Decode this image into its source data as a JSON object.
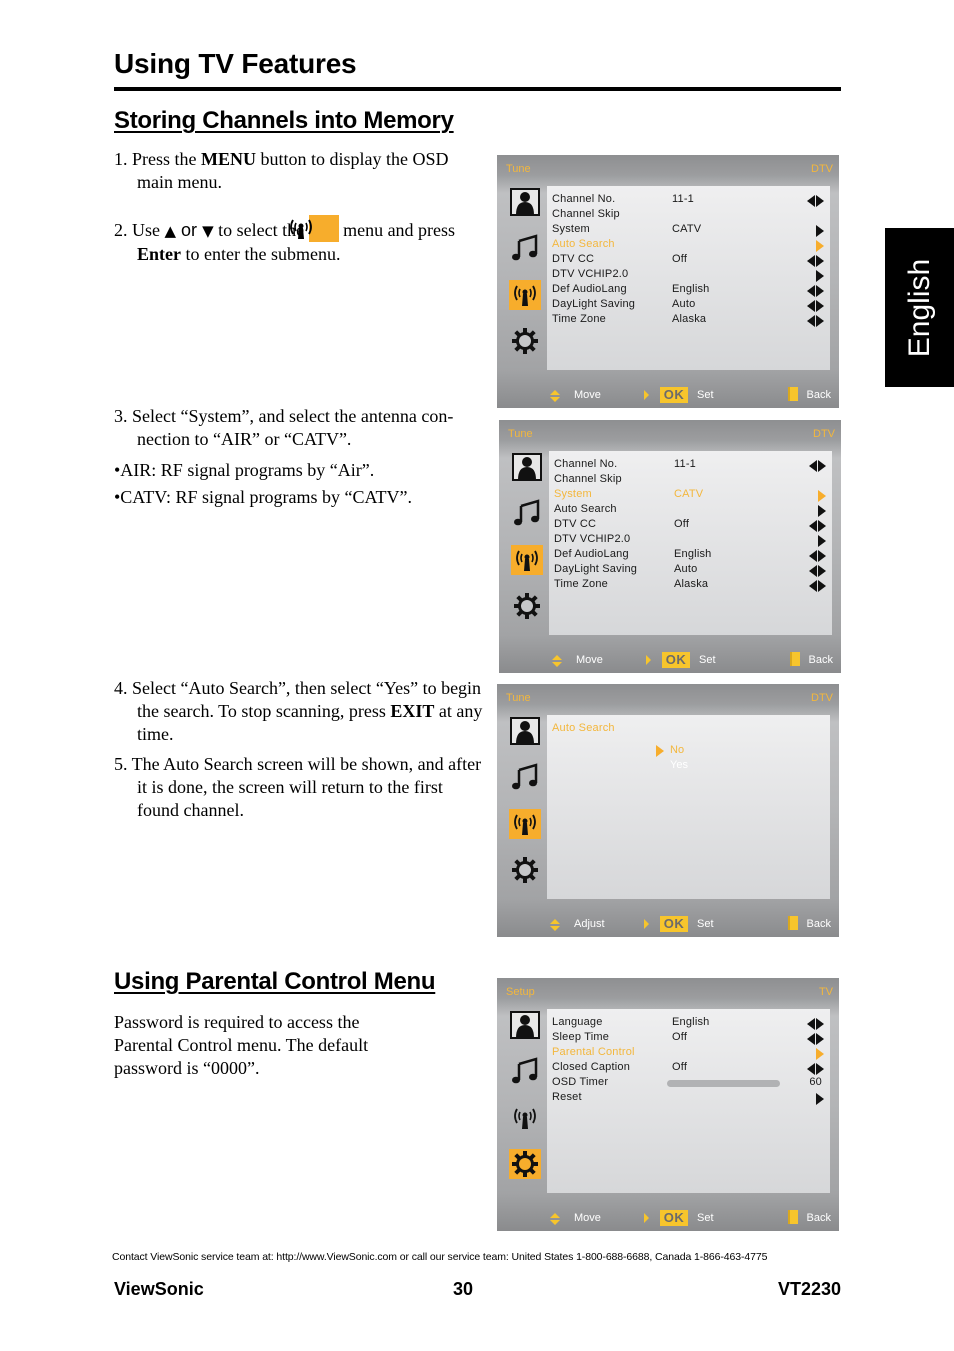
{
  "header": {
    "title": "Using TV Features",
    "language_tab": "English"
  },
  "section1": {
    "title": "Storing Channels into Memory",
    "step1": {
      "prefix": "1. Press the ",
      "bold": "MENU",
      "suffix": " button to display the OSD main menu."
    },
    "step2": {
      "prefix": "2. Use ",
      "up_arrow": "▲",
      "or": " or ",
      "down_arrow": "▼",
      "middle": " to select the ",
      "icon": "antenna-icon",
      "after_icon": " menu and press ",
      "bold": "Enter",
      "suffix": " to enter the submenu."
    },
    "step3": "3. Select “System”, and select the antenna con-nection to “AIR” or “CATV”.",
    "bullet_air": "•AIR: RF signal programs by “Air”.",
    "bullet_catv": "•CATV: RF signal programs by “CATV”.",
    "step4": {
      "prefix": "4. Select “Auto Search”, then select “Yes” to begin the search. To stop scanning, press ",
      "bold": "EXIT",
      "suffix": " at any time."
    },
    "step5": "5. The Auto Search screen will be shown, and after it is done, the screen will return to the first found channel."
  },
  "section2": {
    "title": "Using Parental Control Menu",
    "body": "Password is required to access the Parental Control menu. The default password is “0000”."
  },
  "osd_colors": {
    "accent": "#f7ad2c",
    "highlight_text": "#f3b73d",
    "panel": "#e4e5e6"
  },
  "osd1": {
    "title": "Tune",
    "mode": "DTV",
    "active_icon": "antenna",
    "rows": [
      {
        "label": "Channel No.",
        "value": "11-1",
        "control": "left-right"
      },
      {
        "label": "Channel Skip",
        "value": "",
        "control": "none"
      },
      {
        "label": "System",
        "value": "CATV",
        "control": "right"
      },
      {
        "label": "Auto Search",
        "value": "",
        "control": "right-selected",
        "selected": true
      },
      {
        "label": "DTV CC",
        "value": "Off",
        "control": "left-right"
      },
      {
        "label": "DTV VCHIP2.0",
        "value": "",
        "control": "right"
      },
      {
        "label": "Def AudioLang",
        "value": "English",
        "control": "left-right"
      },
      {
        "label": "DayLight Saving",
        "value": "Auto",
        "control": "left-right"
      },
      {
        "label": "Time Zone",
        "value": "Alaska",
        "control": "left-right"
      }
    ],
    "footer": {
      "nav": "Move",
      "ok": "OK",
      "set": "Set",
      "back": "Back"
    }
  },
  "osd2": {
    "title": "Tune",
    "mode": "DTV",
    "active_icon": "antenna",
    "rows": [
      {
        "label": "Channel No.",
        "value": "11-1",
        "control": "left-right"
      },
      {
        "label": "Channel Skip",
        "value": "",
        "control": "none"
      },
      {
        "label": "System",
        "value": "CATV",
        "control": "right-selected",
        "selected": true
      },
      {
        "label": "Auto Search",
        "value": "",
        "control": "right"
      },
      {
        "label": "DTV CC",
        "value": "Off",
        "control": "left-right"
      },
      {
        "label": "DTV VCHIP2.0",
        "value": "",
        "control": "right"
      },
      {
        "label": "Def AudioLang",
        "value": "English",
        "control": "left-right"
      },
      {
        "label": "DayLight Saving",
        "value": "Auto",
        "control": "left-right"
      },
      {
        "label": "Time Zone",
        "value": "Alaska",
        "control": "left-right"
      }
    ],
    "footer": {
      "nav": "Move",
      "ok": "OK",
      "set": "Set",
      "back": "Back"
    }
  },
  "osd3": {
    "title": "Tune",
    "mode": "DTV",
    "active_icon": "antenna",
    "heading": "Auto Search",
    "options": [
      "No",
      "Yes"
    ],
    "selected_option": "No",
    "footer": {
      "nav": "Adjust",
      "ok": "OK",
      "set": "Set",
      "back": "Back"
    }
  },
  "osd4": {
    "title": "Setup",
    "mode": "TV",
    "active_icon": "gear",
    "rows": [
      {
        "label": "Language",
        "value": "English",
        "control": "left-right"
      },
      {
        "label": "Sleep Time",
        "value": "Off",
        "control": "left-right"
      },
      {
        "label": "Parental Control",
        "value": "",
        "control": "right-selected",
        "selected": true
      },
      {
        "label": "Closed Caption",
        "value": "Off",
        "control": "left-right"
      },
      {
        "label": "OSD Timer",
        "value": "60",
        "control": "slider"
      },
      {
        "label": "Reset",
        "value": "",
        "control": "right"
      }
    ],
    "footer": {
      "nav": "Move",
      "ok": "OK",
      "set": "Set",
      "back": "Back"
    }
  },
  "footer": {
    "contact": "Contact ViewSonic service team at: http://www.ViewSonic.com or call our service team: United States 1-800-688-6688, Canada 1-866-463-4775",
    "brand": "ViewSonic",
    "page_number": "30",
    "model": "VT2230"
  }
}
